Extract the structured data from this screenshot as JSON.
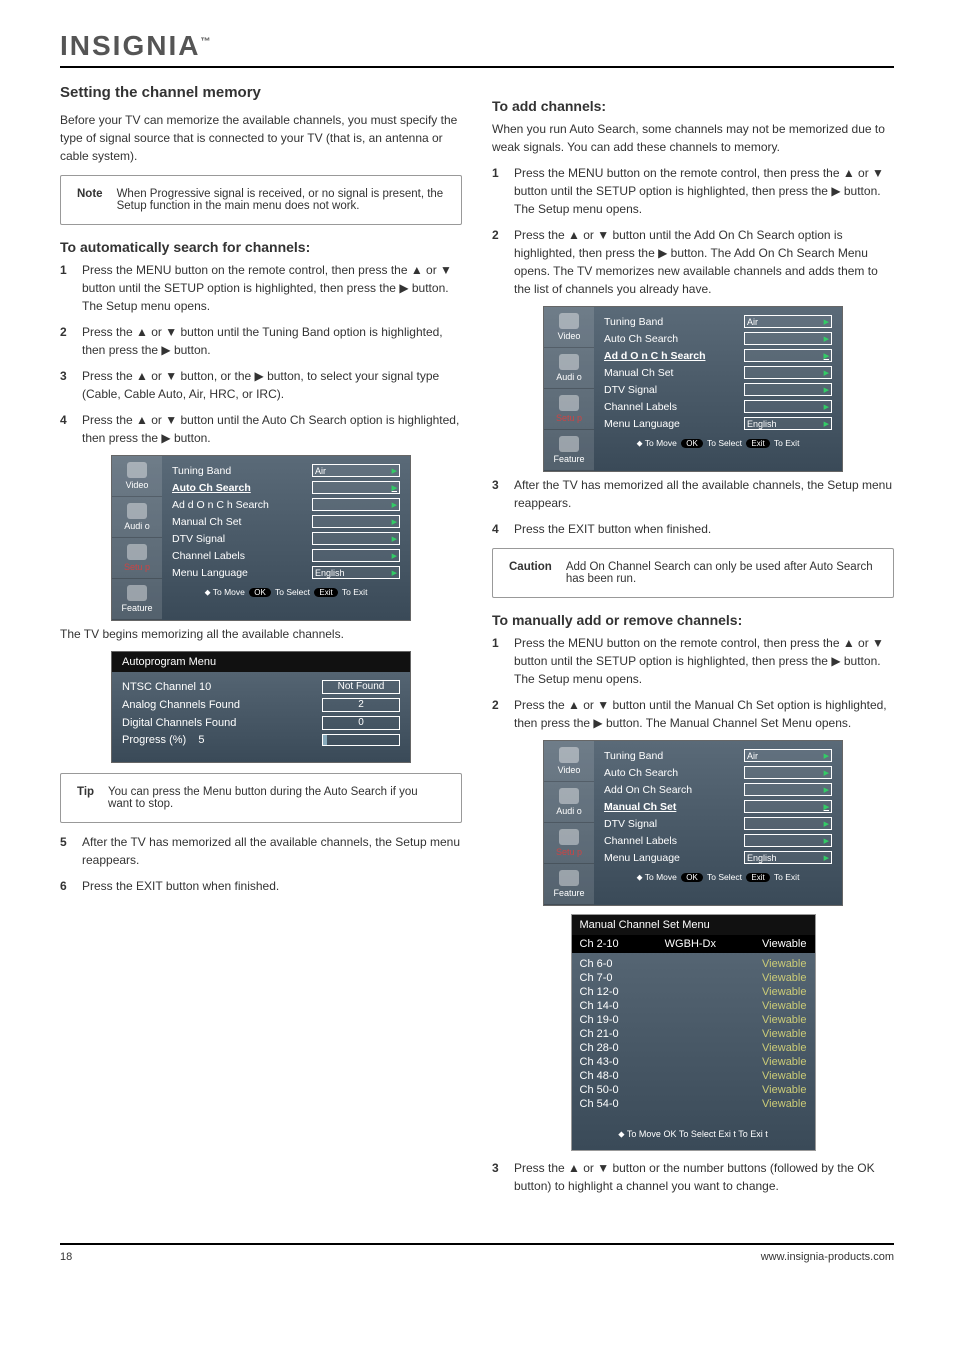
{
  "brand": "INSIGNIA",
  "brand_tm": "™",
  "topic": "Setting the channel memory",
  "intro": "Before your TV can memorize the available channels, you must specify the type of signal source that is connected to your TV (that is, an antenna or cable system).",
  "note1_label": "Note",
  "note1_text": "When Progressive signal is received, or no signal is present, the Setup function in the main menu does not work.",
  "search_title": "To automatically search for channels:",
  "steps_search": {
    "s1": "Press the MENU button on the remote control, then press the ▲ or ▼ button until the SETUP option is highlighted, then press the ▶ button. The Setup menu opens.",
    "s2": "Press the ▲ or ▼ button until the Tuning Band option is highlighted, then press the ▶ button.",
    "s3": "Press the ▲ or ▼ button, or the ▶ button, to select your signal type (Cable, Cable Auto, Air, HRC, or IRC).",
    "s4_a": "Press the ▲ or ▼ button until the Auto Ch Search option is highlighted, then press the ▶ button.",
    "s4_b": "The TV begins memorizing all the available channels.",
    "s5": "After the TV has memorized all the available channels, the Setup menu reappears.",
    "s6": "Press the EXIT button when finished."
  },
  "tip_label": "Tip",
  "tip_text": "You can press the Menu button during the Auto Search if you want to stop.",
  "addon_title": "To add channels:",
  "addon_intro": "When you run Auto Search, some channels may not be memorized due to weak signals. You can add these channels to memory.",
  "steps_addon": {
    "s1": "Press the MENU button on the remote control, then press the ▲ or ▼ button until the SETUP option is highlighted, then press the ▶ button. The Setup menu opens.",
    "s2": "Press the ▲ or ▼ button until the Add On Ch Search option is highlighted, then press the ▶ button. The Add On Ch Search Menu opens. The TV memorizes new available channels and adds them to the list of channels you already have.",
    "s3": "After the TV has memorized all the available channels, the Setup menu reappears.",
    "s4": "Press the EXIT button when finished."
  },
  "caution_label": "Caution",
  "caution_text": "Add On Channel Search can only be used after Auto Search has been run.",
  "manual_title": "To manually add or remove channels:",
  "steps_manual": {
    "s1": "Press the MENU button on the remote control, then press the ▲ or ▼ button until the SETUP option is highlighted, then press the ▶ button. The Setup menu opens.",
    "s2": "Press the ▲ or ▼ button until the Manual Ch Set option is highlighted, then press the ▶ button. The Manual Channel Set Menu opens.",
    "s3": "Press the ▲ or ▼ button or the number buttons (followed by the OK button) to highlight a channel you want to change."
  },
  "tv_sidebar": [
    "Video",
    "Audi o",
    "Setu p",
    "Feature"
  ],
  "tv_menus": {
    "rows": [
      "Tuning Band",
      "Auto Ch Search",
      "Ad d O n C h Search",
      "Manual Ch Set",
      "DTV Signal",
      "Channel Labels",
      "Menu Language"
    ],
    "air": "Air",
    "english": "English",
    "hint_move": "To Move",
    "hint_ok": "OK",
    "hint_select": "To Select",
    "hint_exit": "Exit",
    "hint_toexit": "To Exit"
  },
  "highlight_a": "Auto Ch Search",
  "highlight_b": "Ad d O n C h Search",
  "highlight_b_alt": "Add On Ch Search",
  "highlight_c": "Manual Ch Set",
  "autoprog": {
    "title": "Autoprogram   Menu",
    "r1": "NTSC  Channel   10",
    "r1v": "Not Found",
    "r2": "Analog  Channels   Found",
    "r2v": "2",
    "r3": "Digital  Channels   Found",
    "r3v": "0",
    "r4": "Progress  (%)",
    "r4v": "5"
  },
  "manual_menu": {
    "title": "Manual  Channel  Set  Menu",
    "hdr_ch": "Ch 2-10",
    "hdr_name": "WGBH-Dx",
    "hdr_state": "Viewable",
    "rows": [
      {
        "ch": "Ch  6-0",
        "v": "Viewable"
      },
      {
        "ch": "Ch  7-0",
        "v": "Viewable"
      },
      {
        "ch": "Ch  12-0",
        "v": "Viewable"
      },
      {
        "ch": "Ch  14-0",
        "v": "Viewable"
      },
      {
        "ch": "Ch  19-0",
        "v": "Viewable"
      },
      {
        "ch": "Ch  21-0",
        "v": "Viewable"
      },
      {
        "ch": "Ch  28-0",
        "v": "Viewable"
      },
      {
        "ch": "Ch  43-0",
        "v": "Viewable"
      },
      {
        "ch": "Ch  48-0",
        "v": "Viewable"
      },
      {
        "ch": "Ch  50-0",
        "v": "Viewable"
      },
      {
        "ch": "Ch  54-0",
        "v": "Viewable"
      }
    ],
    "hint": "To Move   OK  To Select   Exi t  To Exi t"
  },
  "footer_left": "18",
  "footer_right": "www.insignia-products.com"
}
